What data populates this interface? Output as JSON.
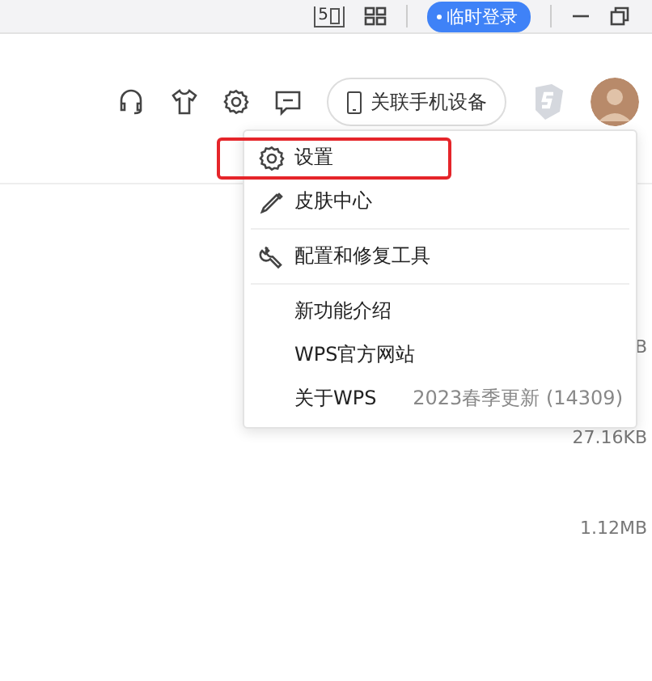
{
  "title_bar": {
    "page_count": "5",
    "login_badge": "临时登录"
  },
  "toolbar": {
    "phone_button": "关联手机设备"
  },
  "files": [
    {
      "size": "B"
    },
    {
      "size": "27.16KB"
    },
    {
      "size": "1.12MB"
    }
  ],
  "menu": {
    "items": [
      {
        "kind": "settings",
        "label": "设置",
        "highlighted": true
      },
      {
        "kind": "skin",
        "label": "皮肤中心",
        "highlighted": false
      },
      {
        "kind": "divider"
      },
      {
        "kind": "repair",
        "label": "配置和修复工具",
        "highlighted": false
      },
      {
        "kind": "divider"
      },
      {
        "kind": "text",
        "label": "新功能介绍",
        "highlighted": false
      },
      {
        "kind": "text",
        "label": "WPS官方网站",
        "highlighted": false
      },
      {
        "kind": "text",
        "label": "关于WPS",
        "note": "2023春季更新 (14309)",
        "highlighted": false
      }
    ]
  }
}
